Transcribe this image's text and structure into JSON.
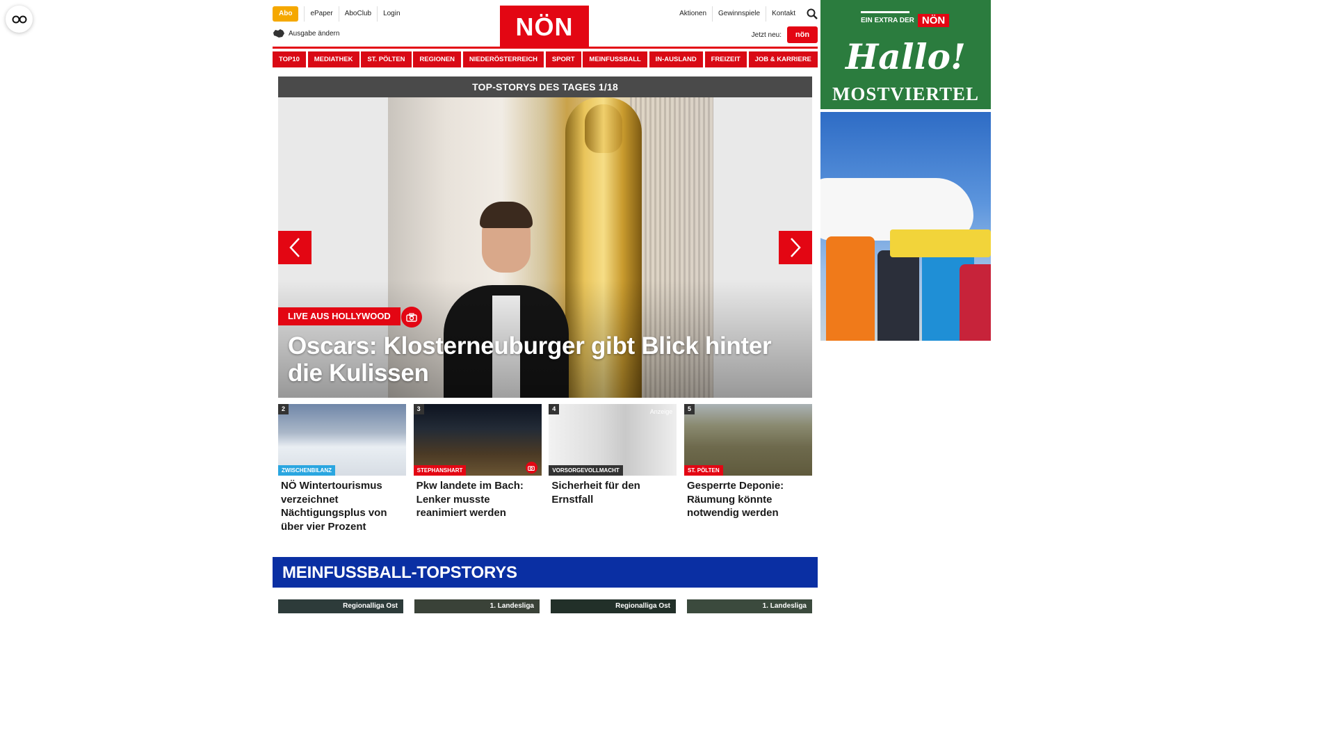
{
  "header": {
    "abo_label": "Abo",
    "left_links": [
      "ePaper",
      "AboClub",
      "Login"
    ],
    "right_links": [
      "Aktionen",
      "Gewinnspiele",
      "Kontakt"
    ],
    "logo_text": "NÖN",
    "ausgabe_label": "Ausgabe ändern",
    "jetzt_label": "Jetzt neu:",
    "jetzt_badge": "nön"
  },
  "categories": [
    "TOP10",
    "MEDIATHEK",
    "ST. PÖLTEN",
    "REGIONEN",
    "NIEDERÖSTERREICH",
    "SPORT",
    "MEINFUSSBALL",
    "IN-AUSLAND",
    "FREIZEIT",
    "JOB & KARRIERE"
  ],
  "topstories": {
    "bar_title": "TOP-STORYS DES TAGES 1/18",
    "hero": {
      "tag": "LIVE AUS HOLLYWOOD",
      "title": "Oscars: Klosterneuburger gibt Blick hinter die Kulissen"
    },
    "cards": [
      {
        "num": "2",
        "tag": "ZWISCHENBILANZ",
        "tag_color": "#2aa6e0",
        "title": "NÖ Wintertourismus verzeichnet Nächtigungsplus von über vier Prozent"
      },
      {
        "num": "3",
        "tag": "STEPHANSHART",
        "tag_color": "#e30613",
        "title": "Pkw landete im Bach: Lenker musste reanimiert werden"
      },
      {
        "num": "4",
        "tag": "VORSORGEVOLLMACHT",
        "tag_color": "#333333",
        "title": "Sicherheit für den Ernstfall",
        "ad_label": "Anzeige"
      },
      {
        "num": "5",
        "tag": "ST. PÖLTEN",
        "tag_color": "#e30613",
        "title": "Gesperrte Deponie: Räumung könnte notwendig werden"
      }
    ]
  },
  "meinfussball": {
    "bar_title": "MEINFUSSBALL-TOPSTORYS",
    "leagues": [
      "Regionalliga Ost",
      "1. Landesliga",
      "Regionalliga Ost",
      "1. Landesliga"
    ]
  },
  "ad": {
    "extra_label": "EIN EXTRA DER",
    "non_label": "NÖN",
    "hallo": "Hallo!",
    "region": "MOSTVIERTEL"
  },
  "colors": {
    "brand_red": "#e30613",
    "abo_orange": "#f5a800",
    "mf_blue": "#0a2fa3",
    "ad_green": "#2b7c3e"
  }
}
